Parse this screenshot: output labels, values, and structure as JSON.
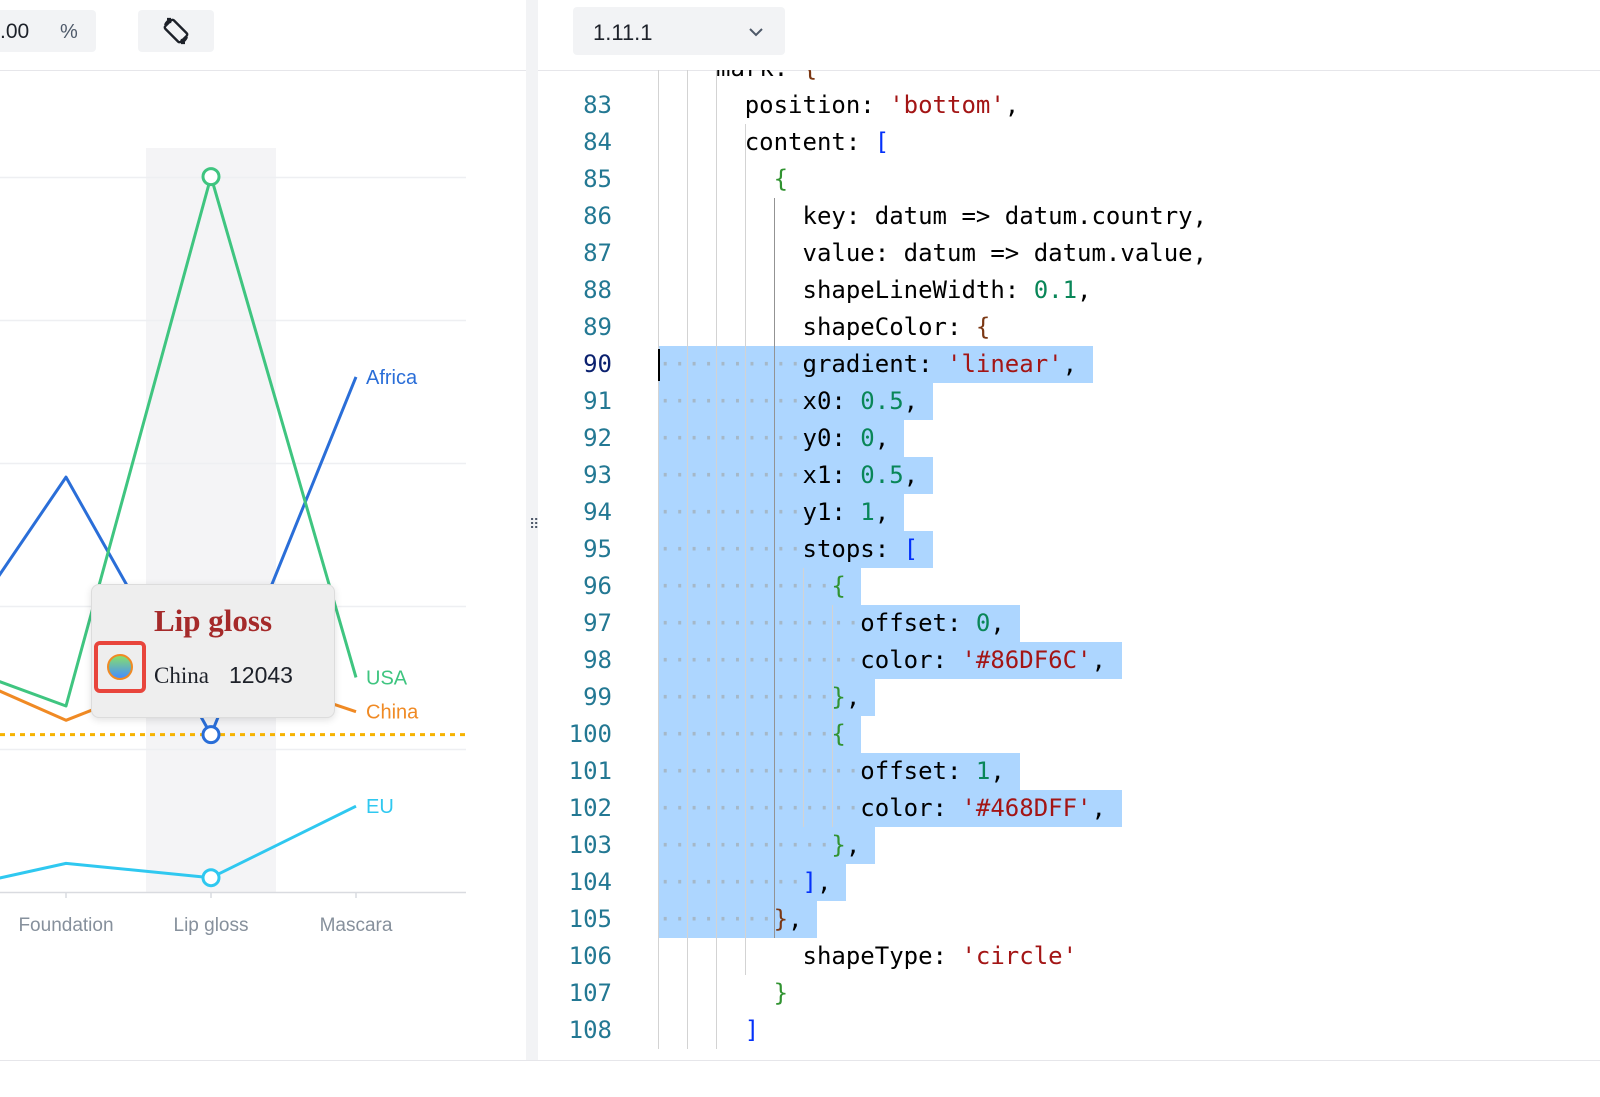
{
  "left_toolbar": {
    "zoom_value": ".00",
    "zoom_unit": "%",
    "rotate_icon": "rotate-screen-icon"
  },
  "chart_data": {
    "type": "line",
    "categories": [
      "Foundation",
      "Lip gloss",
      "Mascara"
    ],
    "series": [
      {
        "name": "Africa",
        "color": "#2a6ed8",
        "values": [
          29000,
          11000,
          36000
        ]
      },
      {
        "name": "USA",
        "color": "#3fc580",
        "values": [
          13000,
          50000,
          15000
        ]
      },
      {
        "name": "China",
        "color": "#f08a24",
        "values": [
          12000,
          16000,
          12600
        ]
      },
      {
        "name": "EU",
        "color": "#2fc8f0",
        "values": [
          2000,
          1000,
          6000
        ]
      }
    ],
    "reference_line": {
      "color": "#f6b300",
      "value": 11000
    },
    "highlighted_category": "Lip gloss",
    "grid": true
  },
  "tooltip": {
    "title": "Lip gloss",
    "series_name": "China",
    "value": "12043",
    "marker_colors": [
      "#86DF6C",
      "#468DFF"
    ]
  },
  "right_toolbar": {
    "version": "1.11.1",
    "chevron_icon": "chevron-down-icon"
  },
  "editor": {
    "active_line": 90,
    "top_partial": "mark: {",
    "lines": [
      {
        "n": "83",
        "indent": 6,
        "tokens": [
          [
            "p",
            "position: "
          ],
          [
            "s",
            "'bottom'"
          ],
          [
            "p",
            ","
          ]
        ]
      },
      {
        "n": "84",
        "indent": 6,
        "tokens": [
          [
            "p",
            "content: "
          ],
          [
            "b1",
            "["
          ]
        ]
      },
      {
        "n": "85",
        "indent": 8,
        "tokens": [
          [
            "b2",
            "{"
          ]
        ]
      },
      {
        "n": "86",
        "indent": 10,
        "tokens": [
          [
            "p",
            "key: datum => datum.country,"
          ]
        ]
      },
      {
        "n": "87",
        "indent": 10,
        "tokens": [
          [
            "p",
            "value: datum => datum.value,"
          ]
        ]
      },
      {
        "n": "88",
        "indent": 10,
        "tokens": [
          [
            "p",
            "shapeLineWidth: "
          ],
          [
            "n",
            "0.1"
          ],
          [
            "p",
            ","
          ]
        ]
      },
      {
        "n": "89",
        "indent": 10,
        "tokens": [
          [
            "p",
            "shapeColor: "
          ],
          [
            "b3",
            "{"
          ]
        ]
      },
      {
        "n": "90",
        "indent": 10,
        "tokens": [
          [
            "p",
            "gradient: "
          ],
          [
            "s",
            "'linear'"
          ],
          [
            "p",
            ","
          ]
        ]
      },
      {
        "n": "91",
        "indent": 10,
        "tokens": [
          [
            "p",
            "x0: "
          ],
          [
            "n",
            "0.5"
          ],
          [
            "p",
            ","
          ]
        ]
      },
      {
        "n": "92",
        "indent": 10,
        "tokens": [
          [
            "p",
            "y0: "
          ],
          [
            "n",
            "0"
          ],
          [
            "p",
            ","
          ]
        ]
      },
      {
        "n": "93",
        "indent": 10,
        "tokens": [
          [
            "p",
            "x1: "
          ],
          [
            "n",
            "0.5"
          ],
          [
            "p",
            ","
          ]
        ]
      },
      {
        "n": "94",
        "indent": 10,
        "tokens": [
          [
            "p",
            "y1: "
          ],
          [
            "n",
            "1"
          ],
          [
            "p",
            ","
          ]
        ]
      },
      {
        "n": "95",
        "indent": 10,
        "tokens": [
          [
            "p",
            "stops: "
          ],
          [
            "b1",
            "["
          ]
        ]
      },
      {
        "n": "96",
        "indent": 12,
        "tokens": [
          [
            "b2",
            "{"
          ]
        ]
      },
      {
        "n": "97",
        "indent": 14,
        "tokens": [
          [
            "p",
            "offset: "
          ],
          [
            "n",
            "0"
          ],
          [
            "p",
            ","
          ]
        ]
      },
      {
        "n": "98",
        "indent": 14,
        "tokens": [
          [
            "p",
            "color: "
          ],
          [
            "s",
            "'#86DF6C'"
          ],
          [
            "p",
            ","
          ]
        ]
      },
      {
        "n": "99",
        "indent": 12,
        "tokens": [
          [
            "b2",
            "}"
          ],
          [
            "p",
            ","
          ]
        ]
      },
      {
        "n": "100",
        "indent": 12,
        "tokens": [
          [
            "b2",
            "{"
          ]
        ]
      },
      {
        "n": "101",
        "indent": 14,
        "tokens": [
          [
            "p",
            "offset: "
          ],
          [
            "n",
            "1"
          ],
          [
            "p",
            ","
          ]
        ]
      },
      {
        "n": "102",
        "indent": 14,
        "tokens": [
          [
            "p",
            "color: "
          ],
          [
            "s",
            "'#468DFF'"
          ],
          [
            "p",
            ","
          ]
        ]
      },
      {
        "n": "103",
        "indent": 12,
        "tokens": [
          [
            "b2",
            "}"
          ],
          [
            "p",
            ","
          ]
        ]
      },
      {
        "n": "104",
        "indent": 10,
        "tokens": [
          [
            "b1",
            "]"
          ],
          [
            "p",
            ","
          ]
        ]
      },
      {
        "n": "105",
        "indent": 8,
        "tokens": [
          [
            "b3",
            "}"
          ],
          [
            "p",
            ","
          ]
        ]
      },
      {
        "n": "106",
        "indent": 10,
        "tokens": [
          [
            "p",
            "shapeType: "
          ],
          [
            "s",
            "'circle'"
          ]
        ]
      },
      {
        "n": "107",
        "indent": 8,
        "tokens": [
          [
            "b2",
            "}"
          ]
        ]
      },
      {
        "n": "108",
        "indent": 6,
        "tokens": [
          [
            "b1",
            "]"
          ]
        ]
      }
    ]
  }
}
